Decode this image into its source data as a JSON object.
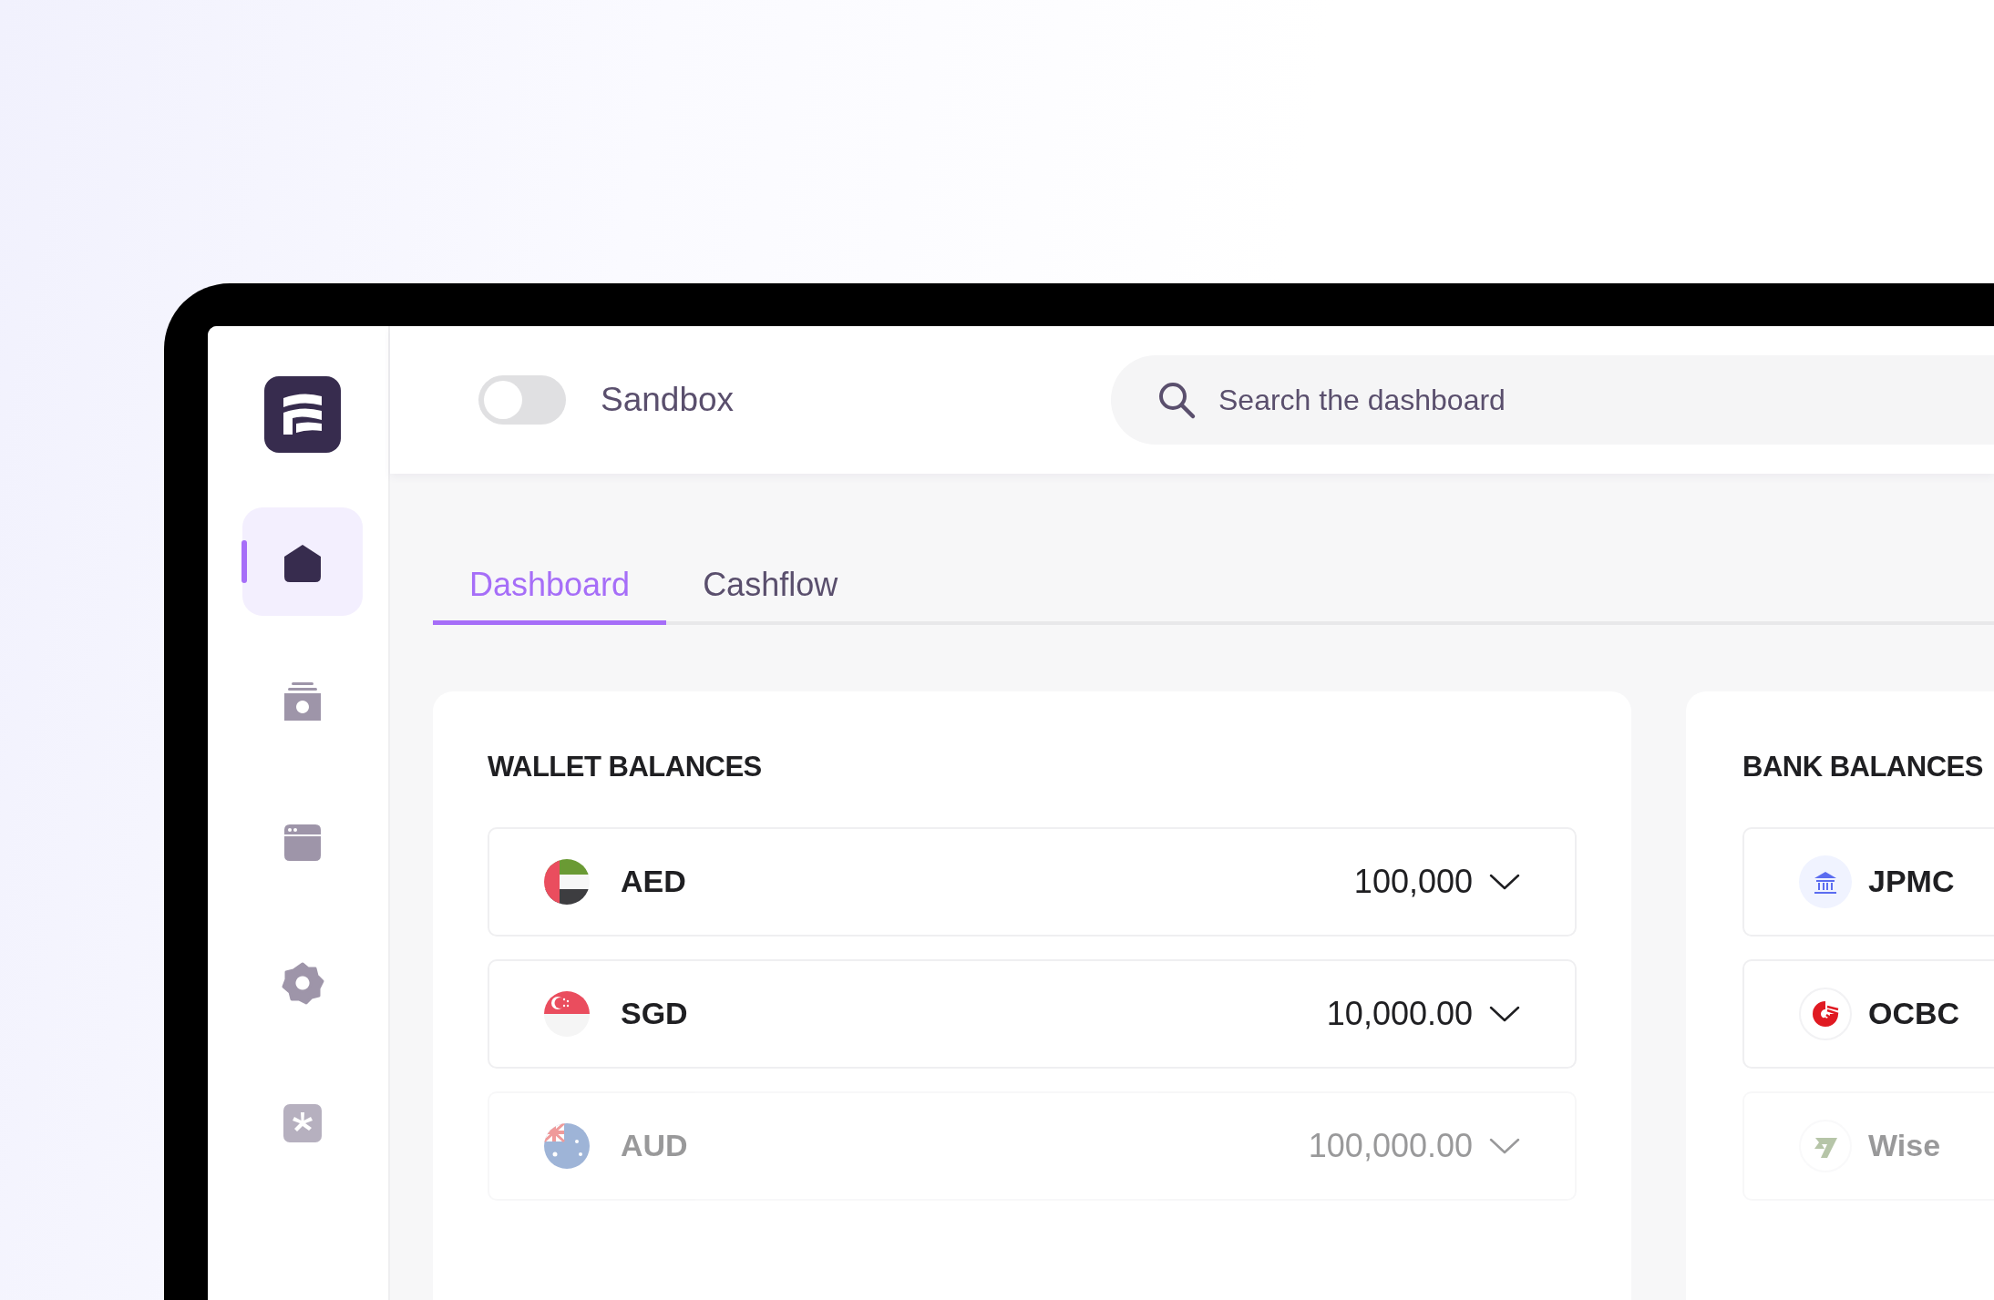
{
  "sidebar": {
    "items": [
      {
        "kind": "home",
        "selected": true
      },
      {
        "kind": "wallet",
        "selected": false
      },
      {
        "kind": "window",
        "selected": false
      },
      {
        "kind": "gear",
        "selected": false
      },
      {
        "kind": "asterisk",
        "selected": false
      }
    ]
  },
  "sandbox_toggle": {
    "label": "Sandbox",
    "on": false
  },
  "search": {
    "placeholder": "Search the dashboard"
  },
  "tabs": [
    {
      "label": "Dashboard",
      "selected": true
    },
    {
      "label": "Cashflow",
      "selected": false
    }
  ],
  "wallet_balances": {
    "title": "WALLET BALANCES",
    "rows": [
      {
        "kind": "ae",
        "currency": "AED",
        "amount": "100,000",
        "faded": false
      },
      {
        "kind": "sg",
        "currency": "SGD",
        "amount": "10,000.00",
        "faded": false
      },
      {
        "kind": "au",
        "currency": "AUD",
        "amount": "100,000.00",
        "faded": true
      }
    ]
  },
  "bank_balances": {
    "title": "BANK BALANCES",
    "rows": [
      {
        "kind": "bank",
        "name": "JPMC",
        "faded": false
      },
      {
        "kind": "ocbc",
        "name": "OCBC",
        "faded": false
      },
      {
        "kind": "wise",
        "name": "Wise",
        "faded": true
      }
    ]
  }
}
